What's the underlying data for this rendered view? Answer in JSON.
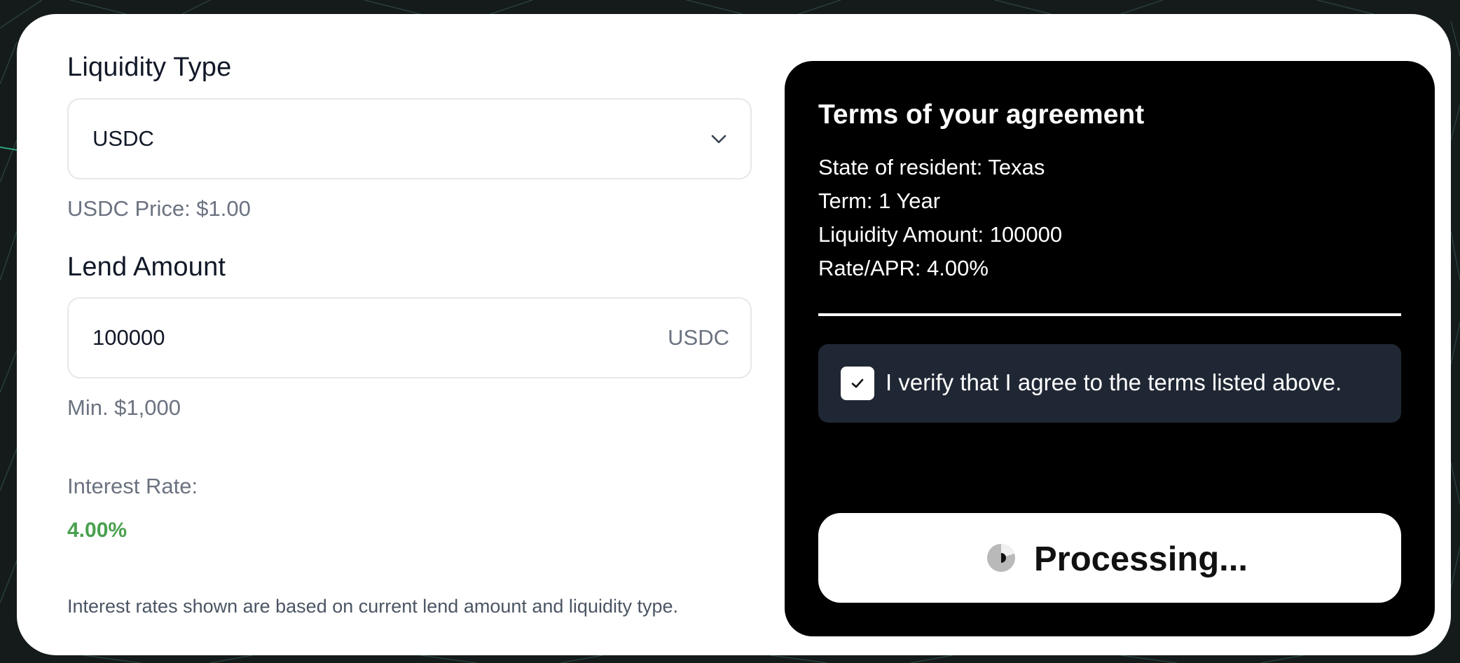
{
  "form": {
    "liquidity_type_label": "Liquidity Type",
    "liquidity_type_value": "USDC",
    "price_text": "USDC Price: $1.00",
    "lend_amount_label": "Lend Amount",
    "lend_amount_value": "100000",
    "lend_amount_suffix": "USDC",
    "min_text": "Min. $1,000",
    "interest_rate_label": "Interest Rate:",
    "interest_rate_value": "4.00%",
    "footnote": "Interest rates shown are based on current lend amount and liquidity type."
  },
  "agreement": {
    "title": "Terms of your agreement",
    "state_line": "State of resident: Texas",
    "term_line": "Term: 1 Year",
    "amount_line": "Liquidity Amount: 100000",
    "rate_line": "Rate/APR: 4.00%",
    "verify_text": "I verify that I agree to the terms listed above.",
    "verify_checked": true,
    "button_label": "Processing..."
  },
  "colors": {
    "accent_green": "#4aa04f",
    "panel_bg": "#000000",
    "verify_bg": "#202734"
  },
  "icons": {
    "select_chevron": "chevron-down-icon",
    "checkbox_mark": "checkmark-icon",
    "button_spinner": "spinner-icon"
  }
}
